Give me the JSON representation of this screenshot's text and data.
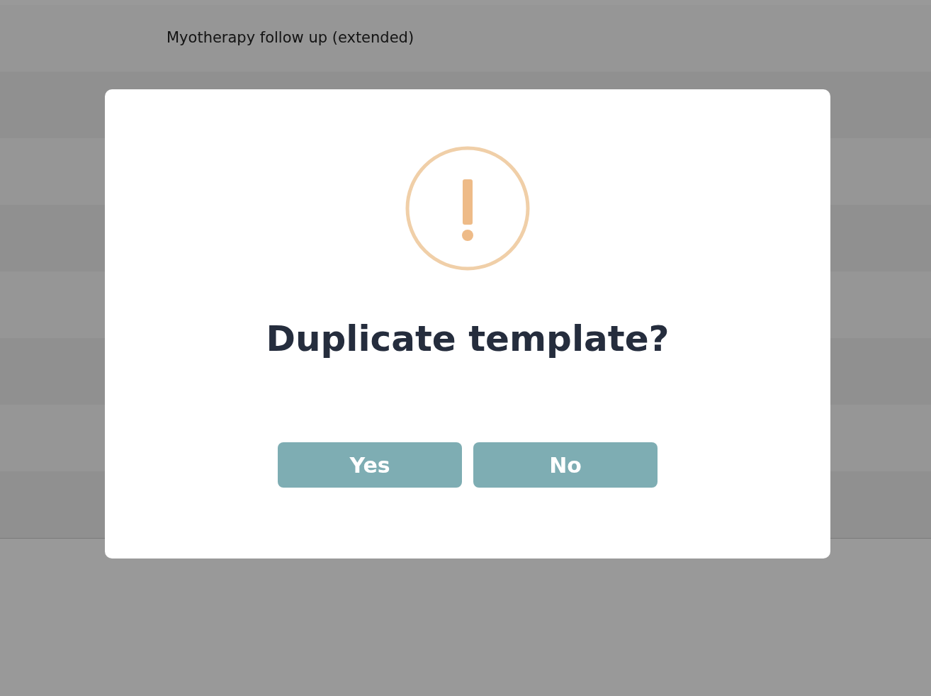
{
  "background": {
    "rows": [
      {
        "title": "Myotherapy follow up (extended)"
      }
    ]
  },
  "dialog": {
    "title": "Duplicate template?",
    "buttons": [
      {
        "label": "Yes"
      },
      {
        "label": "No"
      }
    ]
  }
}
